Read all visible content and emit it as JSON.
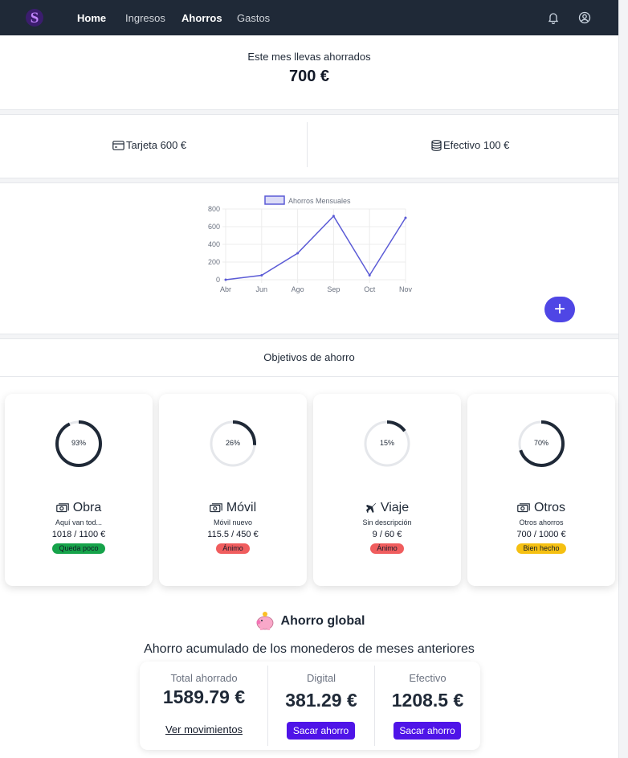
{
  "nav": {
    "links": [
      "Home",
      "Ingresos",
      "Ahorros",
      "Gastos"
    ]
  },
  "summary": {
    "label": "Este mes llevas ahorrados",
    "amount": "700 €"
  },
  "payment": {
    "card": "Tarjeta 600 €",
    "cash": "Efectivo 100 €"
  },
  "chart_data": {
    "type": "line",
    "legend": "Ahorros Mensuales",
    "categories": [
      "Abr",
      "Jun",
      "Ago",
      "Sep",
      "Oct",
      "Nov"
    ],
    "values": [
      0,
      50,
      300,
      720,
      50,
      700
    ],
    "ylim": [
      0,
      800
    ],
    "yticks": [
      "800",
      "600",
      "400",
      "200",
      "0"
    ],
    "color": "#5b5bd6",
    "legend_position": "top"
  },
  "add_button": "+",
  "goals_title": "Objetivos de ahorro",
  "goals": [
    {
      "percent": "93%",
      "fraction": 0.93,
      "name": "Obra",
      "icon": "money-icon",
      "desc": "Aquí van tod...",
      "amount": "1018 / 1100 €",
      "badge": "Queda poco",
      "badge_color": "#16a34a"
    },
    {
      "percent": "26%",
      "fraction": 0.26,
      "name": "Móvil",
      "icon": "money-icon",
      "desc": "Móvil nuevo",
      "amount": "115.5 / 450 €",
      "badge": "Ánimo",
      "badge_color": "#f05d5e"
    },
    {
      "percent": "15%",
      "fraction": 0.15,
      "name": "Viaje",
      "icon": "airplane-icon",
      "desc": "Sin descripción",
      "amount": "9 / 60 €",
      "badge": "Ánimo",
      "badge_color": "#f05d5e"
    },
    {
      "percent": "70%",
      "fraction": 0.7,
      "name": "Otros",
      "icon": "money-icon",
      "desc": "Otros ahorros",
      "amount": "700 / 1000 €",
      "badge": "Bien hecho",
      "badge_color": "#f5c012"
    }
  ],
  "global": {
    "title": "Ahorro global",
    "subtitle": "Ahorro acumulado de los monederos de meses anteriores",
    "total_label": "Total ahorrado",
    "total_value": "1589.79 €",
    "digital_label": "Digital",
    "digital_value": "381.29 €",
    "cash_label": "Efectivo",
    "cash_value": "1208.5 €",
    "movements_link": "Ver movimientos",
    "withdraw_label": "Sacar ahorro"
  }
}
